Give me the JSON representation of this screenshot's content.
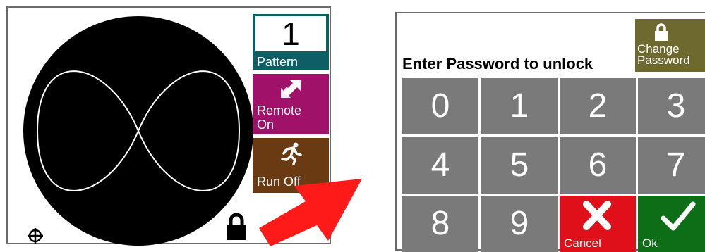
{
  "left": {
    "pattern": {
      "value": "1",
      "label": "Pattern"
    },
    "remote": {
      "label": "Remote\nOn"
    },
    "run": {
      "label": "Run Off"
    }
  },
  "right": {
    "prompt": "Enter Password to unlock",
    "change_password": {
      "label": "Change\nPassword"
    },
    "keys": [
      "0",
      "1",
      "2",
      "3",
      "4",
      "5",
      "6",
      "7",
      "8",
      "9"
    ],
    "cancel_label": "Cancel",
    "ok_label": "Ok"
  },
  "colors": {
    "pattern": "#0e5e66",
    "remote": "#a0126a",
    "run": "#6a3a12",
    "change": "#6e6a2f",
    "key": "#7a7a7a",
    "cancel": "#e0101b",
    "ok": "#0e6e18",
    "arrow": "#ff1a1a"
  },
  "icons": [
    "infinity-pattern-icon",
    "crosshair-icon",
    "lock-icon",
    "remote-arrows-icon",
    "runner-icon",
    "padlock-icon",
    "x-icon",
    "checkmark-icon"
  ]
}
